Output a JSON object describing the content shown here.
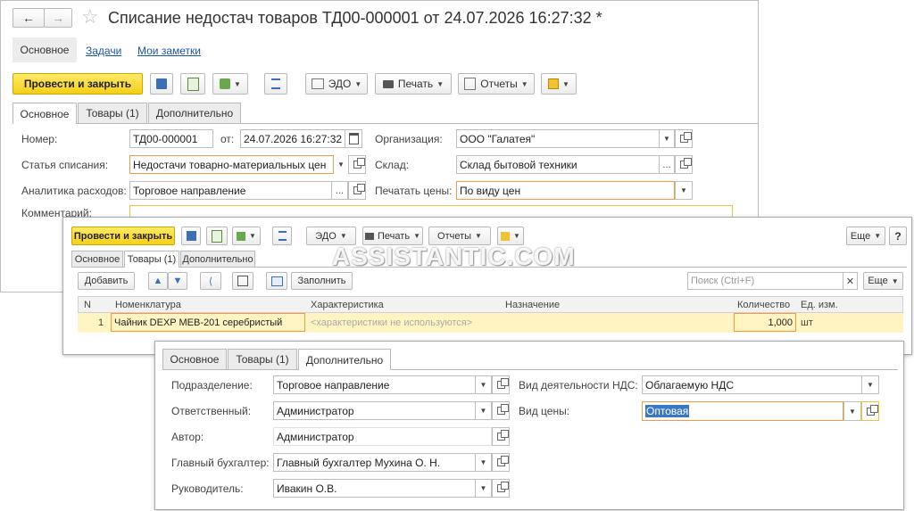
{
  "window1": {
    "title": "Списание недостач товаров ТД00-000001 от 24.07.2026 16:27:32 *",
    "nav_tabs": [
      "Основное",
      "Задачи",
      "Мои заметки"
    ],
    "toolbar": {
      "post_close": "Провести и закрыть",
      "edo": "ЭДО",
      "print": "Печать",
      "reports": "Отчеты"
    },
    "form_tabs": [
      "Основное",
      "Товары (1)",
      "Дополнительно"
    ],
    "fields": {
      "number_label": "Номер:",
      "number_value": "ТД00-000001",
      "date_label": "от:",
      "date_value": "24.07.2026 16:27:32",
      "org_label": "Организация:",
      "org_value": "ООО \"Галатея\"",
      "article_label": "Статья списания:",
      "article_value": "Недостачи товарно-материальных цен",
      "warehouse_label": "Склад:",
      "warehouse_value": "Склад бытовой техники",
      "analytics_label": "Аналитика расходов:",
      "analytics_value": "Торговое направление",
      "print_prices_label": "Печатать цены:",
      "print_prices_value": "По виду цен",
      "comment_label": "Комментарий:"
    }
  },
  "window2": {
    "toolbar": {
      "post_close": "Провести и закрыть",
      "edo": "ЭДО",
      "print": "Печать",
      "reports": "Отчеты",
      "more": "Еще"
    },
    "form_tabs": [
      "Основное",
      "Товары (1)",
      "Дополнительно"
    ],
    "table_toolbar": {
      "add": "Добавить",
      "fill": "Заполнить",
      "search_placeholder": "Поиск (Ctrl+F)",
      "more": "Еще"
    },
    "columns": [
      "N",
      "Номенклатура",
      "Характеристика",
      "Назначение",
      "Количество",
      "Ед. изм."
    ],
    "rows": [
      {
        "n": "1",
        "item": "Чайник DEXP MEB-201 серебристый",
        "characteristic": "<характеристики не используются>",
        "purpose": "",
        "qty": "1,000",
        "unit": "шт"
      }
    ]
  },
  "window3": {
    "form_tabs": [
      "Основное",
      "Товары (1)",
      "Дополнительно"
    ],
    "fields": {
      "division_label": "Подразделение:",
      "division_value": "Торговое направление",
      "responsible_label": "Ответственный:",
      "responsible_value": "Администратор",
      "author_label": "Автор:",
      "author_value": "Администратор",
      "accountant_label": "Главный бухгалтер:",
      "accountant_value": "Главный бухгалтер Мухина О. Н.",
      "head_label": "Руководитель:",
      "head_value": "Ивакин О.В.",
      "vat_label": "Вид деятельности НДС:",
      "vat_value": "Облагаемую НДС",
      "price_type_label": "Вид цены:",
      "price_type_value": "Оптовая"
    }
  },
  "watermark": "ASSISTANTIC.COM",
  "colors": {
    "accent_yellow": "#f5cf17",
    "focus_orange": "#f29b46",
    "link_blue": "#1a57a3",
    "row_highlight": "#fff4c2"
  }
}
